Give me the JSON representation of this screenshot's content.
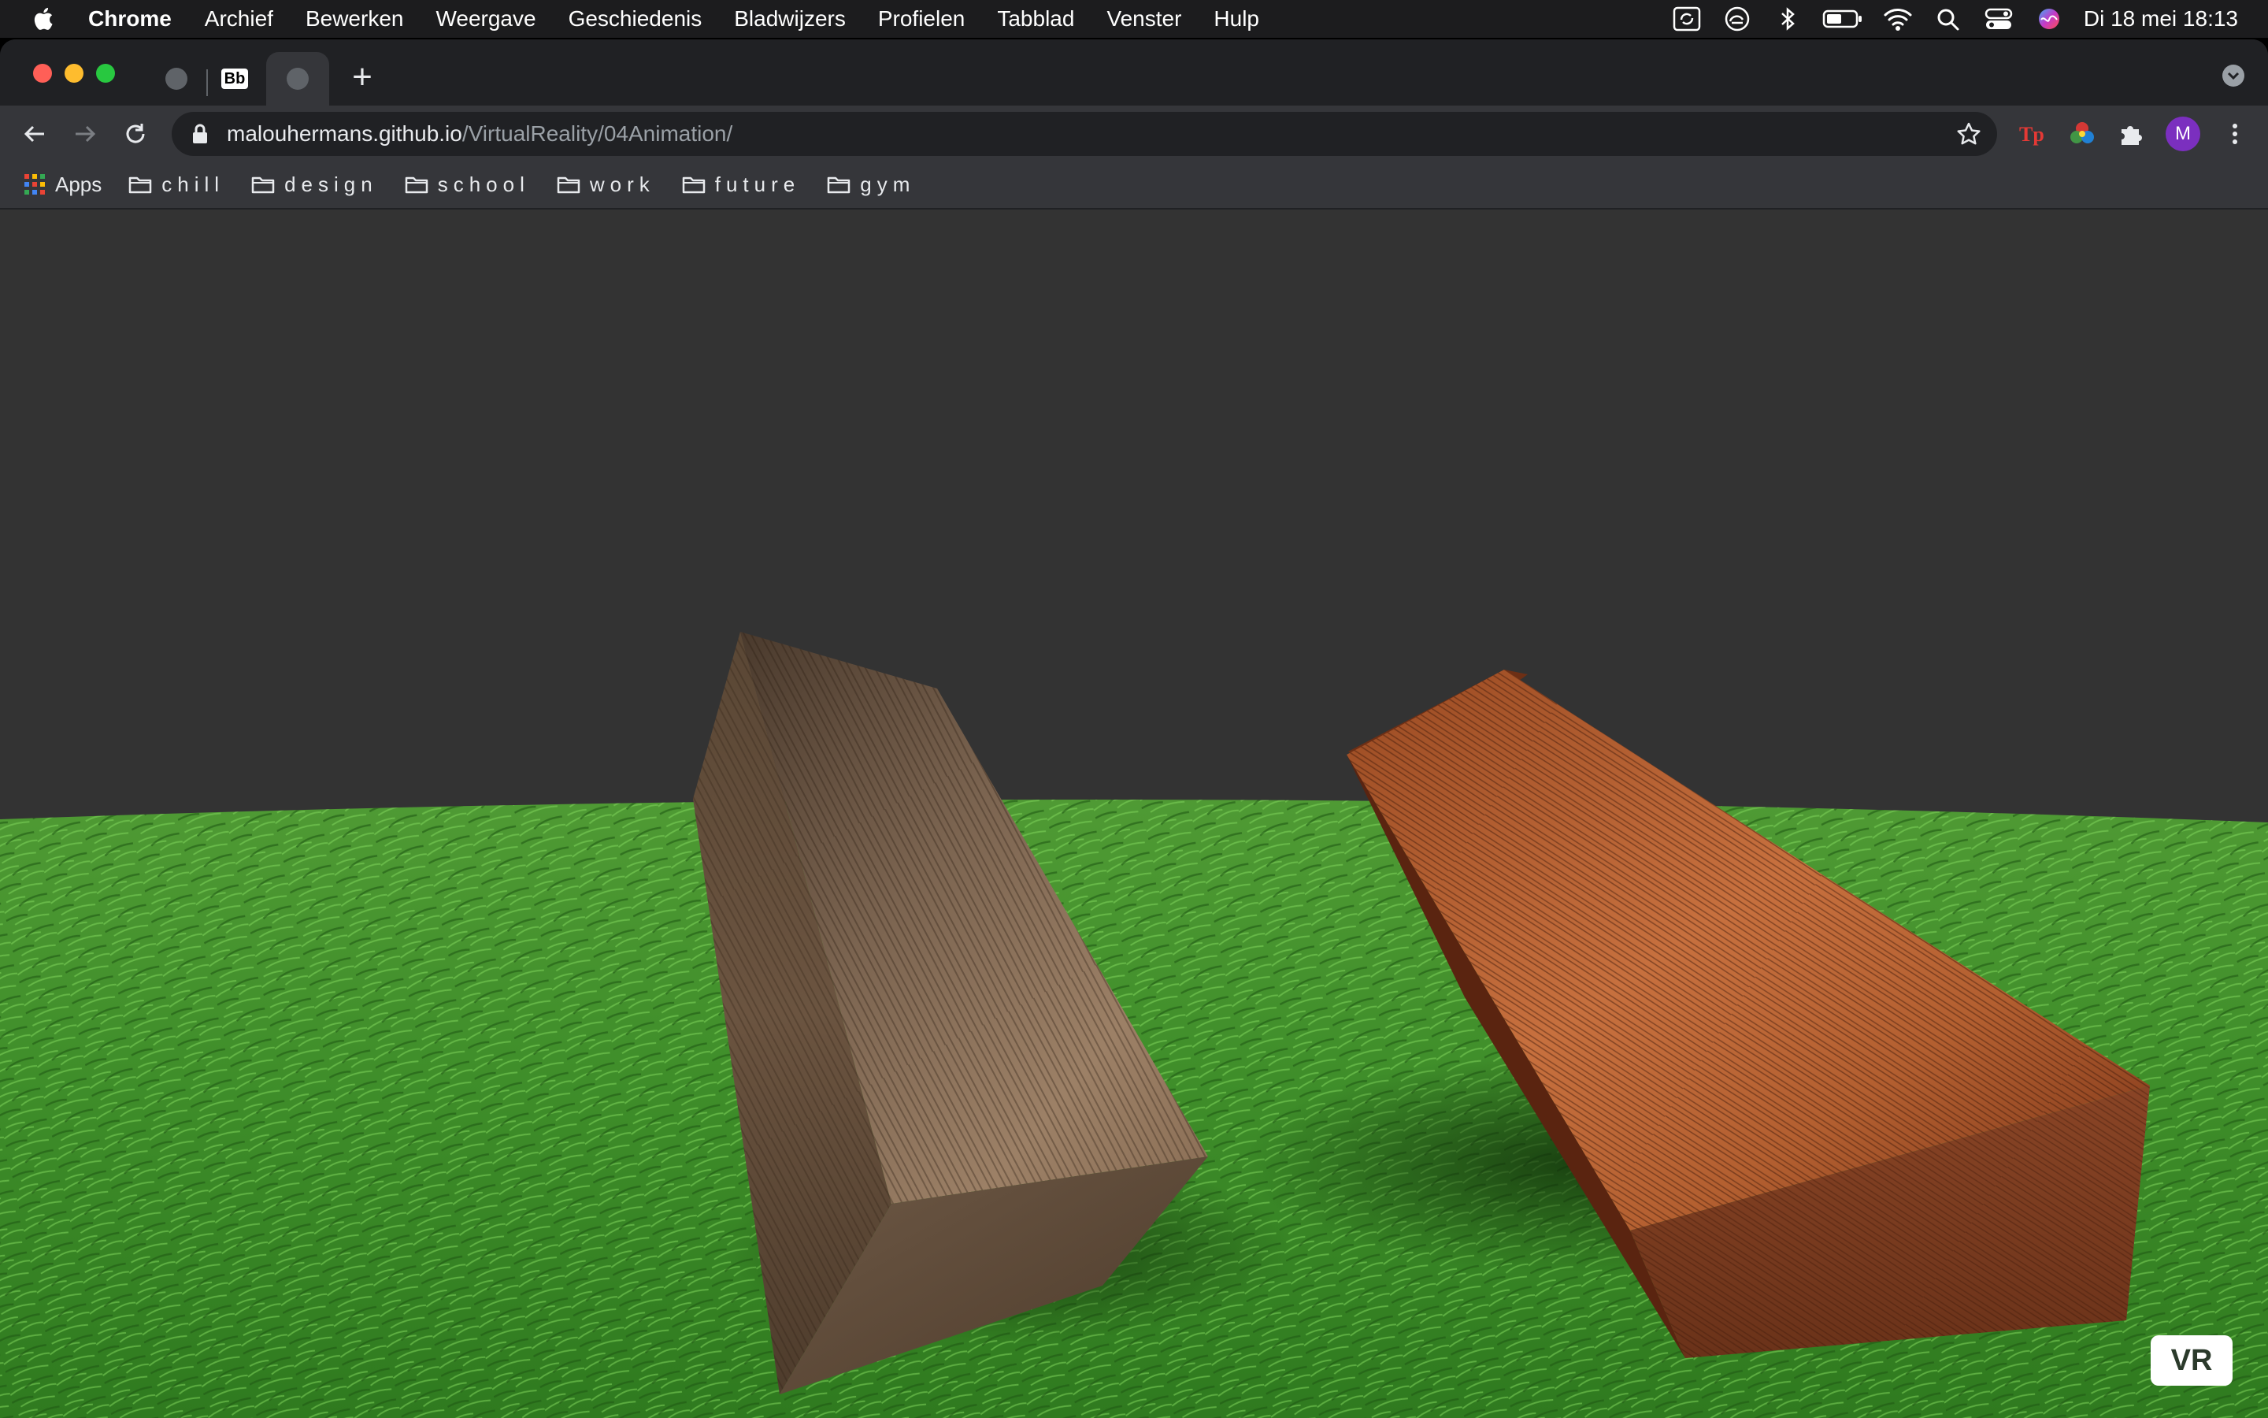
{
  "menubar": {
    "app_name": "Chrome",
    "items": [
      "Archief",
      "Bewerken",
      "Weergave",
      "Geschiedenis",
      "Bladwijzers",
      "Profielen",
      "Tabblad",
      "Venster",
      "Hulp"
    ],
    "clock": "Di 18 mei  18:13",
    "status_icons": [
      "screen-share-icon",
      "creative-cloud-icon",
      "bluetooth-icon",
      "battery-icon",
      "wifi-icon",
      "spotlight-search-icon",
      "control-center-icon",
      "siri-icon"
    ]
  },
  "tabs": {
    "items": [
      {
        "icon": "globe-icon"
      },
      {
        "icon": "bb-favicon",
        "label": "Bb"
      },
      {
        "icon": "globe-icon",
        "active": true
      }
    ],
    "new_tab": "+"
  },
  "address_bar": {
    "host": "malouhermans.github.io",
    "path": "/VirtualReality/04Animation/"
  },
  "extensions": [
    "tp-extension-icon",
    "color-picker-extension-icon",
    "puzzle-extensions-icon"
  ],
  "profile": {
    "initial": "M",
    "color": "#7b2fbf"
  },
  "bookmarks": {
    "apps_label": "Apps",
    "folders": [
      "chill",
      "design",
      "school",
      "work",
      "future",
      "gym"
    ]
  },
  "scene": {
    "sky_color": "#333333",
    "ground": "grass",
    "objects": [
      "dark-wood-block",
      "red-wood-block"
    ],
    "vr_button_label": "VR"
  }
}
